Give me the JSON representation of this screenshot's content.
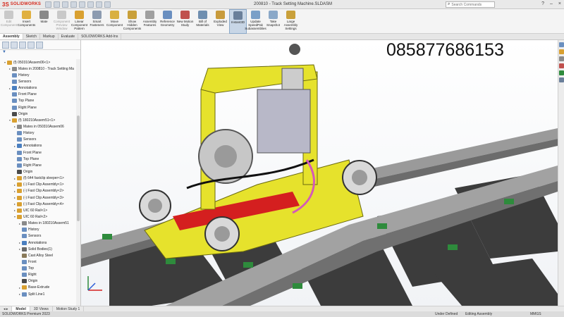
{
  "app": {
    "name": "SOLIDWORKS",
    "logo_mark": "3S"
  },
  "document_title": "200810 - Track Setting Machine.SLDASM",
  "search": {
    "placeholder": "Search Commands"
  },
  "ribbon": {
    "buttons": [
      {
        "label": "Edit Component",
        "icon": "edit-component-icon",
        "color": "#c9c9c9",
        "disabled": true
      },
      {
        "label": "Insert Components",
        "icon": "insert-components-icon",
        "color": "#e0b040",
        "disabled": false
      },
      {
        "label": "Mate",
        "icon": "mate-icon",
        "color": "#8a8a8a",
        "disabled": false
      },
      {
        "label": "Component Preview Window",
        "icon": "component-preview-icon",
        "color": "#c9c9c9",
        "disabled": true
      },
      {
        "label": "Linear Component Pattern",
        "icon": "linear-pattern-icon",
        "color": "#d9a030",
        "disabled": false
      },
      {
        "label": "Smart Fasteners",
        "icon": "smart-fasteners-icon",
        "color": "#8c9bb0",
        "disabled": false
      },
      {
        "label": "Move Component",
        "icon": "move-component-icon",
        "color": "#d9b040",
        "disabled": false
      },
      {
        "label": "Show Hidden Components",
        "icon": "show-hidden-icon",
        "color": "#c9a03a",
        "disabled": false
      },
      {
        "label": "Assembly Features",
        "icon": "assembly-features-icon",
        "color": "#a0a0a0",
        "disabled": false
      },
      {
        "label": "Reference Geometry",
        "icon": "reference-geometry-icon",
        "color": "#6a8fc0",
        "disabled": false
      },
      {
        "label": "New Motion Study",
        "icon": "motion-study-icon",
        "color": "#c0504d",
        "disabled": false
      },
      {
        "label": "Bill of Materials",
        "icon": "bill-of-materials-icon",
        "color": "#6f8fb0",
        "disabled": false
      },
      {
        "label": "Exploded View",
        "icon": "exploded-view-icon",
        "color": "#c89b3c",
        "disabled": false
      },
      {
        "label": "Instant3D",
        "icon": "instant3d-icon",
        "color": "#6a7f9a",
        "disabled": false,
        "active": true
      },
      {
        "label": "Update SpeedPak Subassemblies",
        "icon": "speedpak-icon",
        "color": "#7aa0c8",
        "disabled": false
      },
      {
        "label": "Take Snapshot",
        "icon": "snapshot-icon",
        "color": "#8aa8c8",
        "disabled": false
      },
      {
        "label": "Large Assembly Settings",
        "icon": "large-assembly-icon",
        "color": "#c9a03a",
        "disabled": false
      }
    ]
  },
  "command_tabs": [
    "Assembly",
    "Sketch",
    "Markup",
    "Evaluate",
    "SOLIDWORKS Add-Ins"
  ],
  "tree": [
    {
      "depth": 0,
      "arrow": "▾",
      "icon": "#d9a030",
      "label": "(f) 050310Assem06<1>"
    },
    {
      "depth": 1,
      "arrow": "▸",
      "icon": "#8a8a8a",
      "label": "Mates in 200810 - Track Setting Ma"
    },
    {
      "depth": 1,
      "arrow": "",
      "icon": "#6a8fc0",
      "label": "History"
    },
    {
      "depth": 1,
      "arrow": "",
      "icon": "#6a8fc0",
      "label": "Sensors"
    },
    {
      "depth": 1,
      "arrow": "▸",
      "icon": "#4a7fc0",
      "label": "Annotations"
    },
    {
      "depth": 1,
      "arrow": "",
      "icon": "#6a8fc0",
      "label": "Front Plane"
    },
    {
      "depth": 1,
      "arrow": "",
      "icon": "#6a8fc0",
      "label": "Top Plane"
    },
    {
      "depth": 1,
      "arrow": "",
      "icon": "#6a8fc0",
      "label": "Right Plane"
    },
    {
      "depth": 1,
      "arrow": "",
      "icon": "#4a4a4a",
      "label": "Origin"
    },
    {
      "depth": 1,
      "arrow": "▾",
      "icon": "#d9a030",
      "label": "(f) 180210Assem51<1>"
    },
    {
      "depth": 2,
      "arrow": "▸",
      "icon": "#8a8a8a",
      "label": "Mates in 050310Assem06"
    },
    {
      "depth": 2,
      "arrow": "",
      "icon": "#6a8fc0",
      "label": "History"
    },
    {
      "depth": 2,
      "arrow": "",
      "icon": "#6a8fc0",
      "label": "Sensors"
    },
    {
      "depth": 2,
      "arrow": "▸",
      "icon": "#4a7fc0",
      "label": "Annotations"
    },
    {
      "depth": 2,
      "arrow": "",
      "icon": "#6a8fc0",
      "label": "Front Plane"
    },
    {
      "depth": 2,
      "arrow": "",
      "icon": "#6a8fc0",
      "label": "Top Plane"
    },
    {
      "depth": 2,
      "arrow": "",
      "icon": "#6a8fc0",
      "label": "Right Plane"
    },
    {
      "depth": 2,
      "arrow": "",
      "icon": "#4a4a4a",
      "label": "Origin"
    },
    {
      "depth": 2,
      "arrow": "▸",
      "icon": "#d9a030",
      "label": "(f) 644 fastclip sleeper<1>"
    },
    {
      "depth": 2,
      "arrow": "▸",
      "icon": "#d9a030",
      "label": "(-) Fast Clip Assembly<1>"
    },
    {
      "depth": 2,
      "arrow": "▸",
      "icon": "#d9a030",
      "label": "(-) Fast Clip Assembly<2>"
    },
    {
      "depth": 2,
      "arrow": "▸",
      "icon": "#d9a030",
      "label": "(-) Fast Clip Assembly<3>"
    },
    {
      "depth": 2,
      "arrow": "▸",
      "icon": "#d9a030",
      "label": "(-) Fast Clip Assembly<4>"
    },
    {
      "depth": 2,
      "arrow": "▸",
      "icon": "#d9a030",
      "label": "UIC 60 Rail<1>"
    },
    {
      "depth": 2,
      "arrow": "▾",
      "icon": "#d9a030",
      "label": "UIC 60 Rail<2>"
    },
    {
      "depth": 3,
      "arrow": "▸",
      "icon": "#8a8a8a",
      "label": "Mates in 180210Assem51"
    },
    {
      "depth": 3,
      "arrow": "",
      "icon": "#6a8fc0",
      "label": "History"
    },
    {
      "depth": 3,
      "arrow": "",
      "icon": "#6a8fc0",
      "label": "Sensors"
    },
    {
      "depth": 3,
      "arrow": "▸",
      "icon": "#4a7fc0",
      "label": "Annotations"
    },
    {
      "depth": 3,
      "arrow": "▸",
      "icon": "#6a6a6a",
      "label": "Solid Bodies(1)"
    },
    {
      "depth": 3,
      "arrow": "",
      "icon": "#8a7a5a",
      "label": "Cast Alloy Steel"
    },
    {
      "depth": 3,
      "arrow": "",
      "icon": "#6a8fc0",
      "label": "Front"
    },
    {
      "depth": 3,
      "arrow": "",
      "icon": "#6a8fc0",
      "label": "Top"
    },
    {
      "depth": 3,
      "arrow": "",
      "icon": "#6a8fc0",
      "label": "Right"
    },
    {
      "depth": 3,
      "arrow": "",
      "icon": "#4a4a4a",
      "label": "Origin"
    },
    {
      "depth": 3,
      "arrow": "▸",
      "icon": "#d9a030",
      "label": "Base-Extrude"
    },
    {
      "depth": 3,
      "arrow": "▸",
      "icon": "#6a8fc0",
      "label": "Split Line1"
    }
  ],
  "viewport": {
    "phone_overlay": "085877686153"
  },
  "bottom_tabs": [
    "Model",
    "3D Views",
    "Motion Study 1"
  ],
  "status": {
    "app_version": "SOLIDWORKS Premium 2023",
    "definition": "Under Defined",
    "editing": "Editing Assembly",
    "units": "MMGS"
  }
}
